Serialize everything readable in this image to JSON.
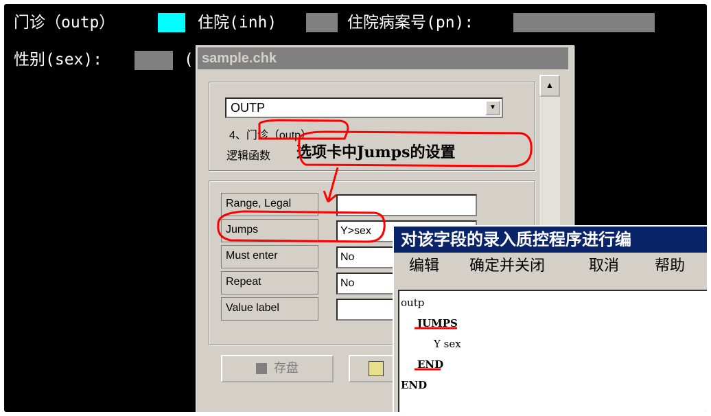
{
  "form": {
    "line1_outp": "门诊（outp）",
    "line1_inh": "住院(inh)",
    "line1_pn": "住院病案号(pn):",
    "line2_sex": "性别(sex):",
    "line2_paren": "(",
    "colors": {
      "cyan_field": "#00ffff",
      "gray_field": "#808080"
    }
  },
  "dialog": {
    "title": "sample.chk",
    "combo_value": "OUTP",
    "desc_line1": "4、门诊（outp）",
    "desc_line2": "逻辑函数",
    "rows": [
      {
        "label": "Range, Legal",
        "value": ""
      },
      {
        "label": "Jumps",
        "value": "Y>sex"
      },
      {
        "label": "Must enter",
        "value": "No"
      },
      {
        "label": "Repeat",
        "value": "No"
      },
      {
        "label": "Value label",
        "value": ""
      }
    ],
    "save_button": "存盘",
    "scroll_up_icon": "scroll-up-arrow"
  },
  "annotation": {
    "callout_text": "选项卡中Jumps的设置",
    "highlight_color": "#ff0000"
  },
  "editor": {
    "title": "对该字段的录入质控程序进行编",
    "menu": [
      "编辑",
      "确定并关闭",
      "取消",
      "帮助"
    ],
    "code_lines": [
      "outp",
      "JUMPS",
      "Y sex",
      "END",
      "END"
    ]
  }
}
